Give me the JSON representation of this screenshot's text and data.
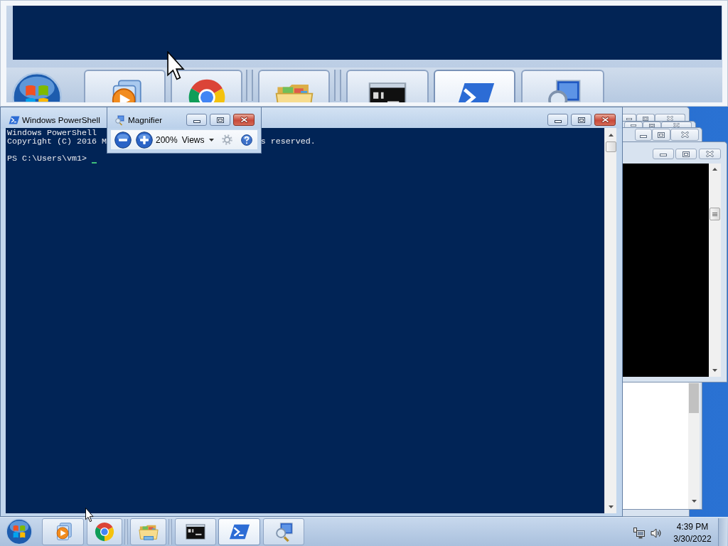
{
  "magnifier_view": {
    "taskbar_buttons": [
      {
        "kind": "media",
        "selected": false
      },
      {
        "kind": "browser",
        "selected": false
      },
      {
        "kind": "folder",
        "selected": false
      },
      {
        "kind": "command",
        "selected": false
      },
      {
        "kind": "powershell",
        "selected": true
      },
      {
        "kind": "magnifier",
        "selected": false
      }
    ]
  },
  "powershell_window": {
    "title": "Windows PowerShell",
    "active": true,
    "console_lines": [
      {
        "segments": [
          "Windows PowerShell"
        ]
      },
      {
        "segments": [
          "Copyright (C) 2016 M",
          "s reserved."
        ]
      }
    ],
    "prompt": "PS C:\\Users\\vm1>"
  },
  "magnifier_window": {
    "title": "Magnifier",
    "active": true,
    "zoom_level": "200%",
    "views_button": "Views"
  },
  "background_windows": [
    {
      "kind": "caption",
      "active": false
    },
    {
      "kind": "caption",
      "active": false
    },
    {
      "kind": "caption",
      "active": false
    },
    {
      "kind": "console",
      "active": false
    },
    {
      "kind": "document"
    }
  ],
  "taskbar": {
    "buttons": [
      {
        "kind": "media",
        "selected": false
      },
      {
        "kind": "browser",
        "selected": false
      },
      {
        "kind": "folder",
        "selected": false
      },
      {
        "kind": "command",
        "selected": false
      },
      {
        "kind": "powershell",
        "selected": true
      },
      {
        "kind": "magnifier",
        "selected": false
      }
    ],
    "clock": {
      "time": "4:39 PM",
      "date": "3/30/2022"
    }
  }
}
